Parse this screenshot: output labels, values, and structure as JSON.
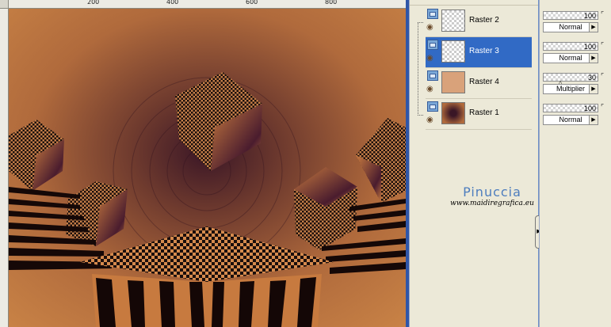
{
  "ruler": {
    "top_labels": [
      "200",
      "400",
      "600",
      "800"
    ]
  },
  "layers": [
    {
      "name": "Raster 2",
      "selected": false
    },
    {
      "name": "Raster 3",
      "selected": true
    },
    {
      "name": "Raster 4",
      "selected": false
    },
    {
      "name": "Raster 1",
      "selected": false
    }
  ],
  "properties": [
    {
      "opacity": "100",
      "blend": "Normal"
    },
    {
      "opacity": "100",
      "blend": "Normal"
    },
    {
      "opacity": "30",
      "blend": "Multiplier"
    },
    {
      "opacity": "100",
      "blend": "Normal"
    }
  ],
  "watermark": {
    "name": "Pinuccia",
    "url": "www.maidiregrafica.eu"
  },
  "colors": {
    "selection": "#316ac5",
    "panel_bg": "#ece9d8",
    "accent_blue": "#2f56a8"
  }
}
